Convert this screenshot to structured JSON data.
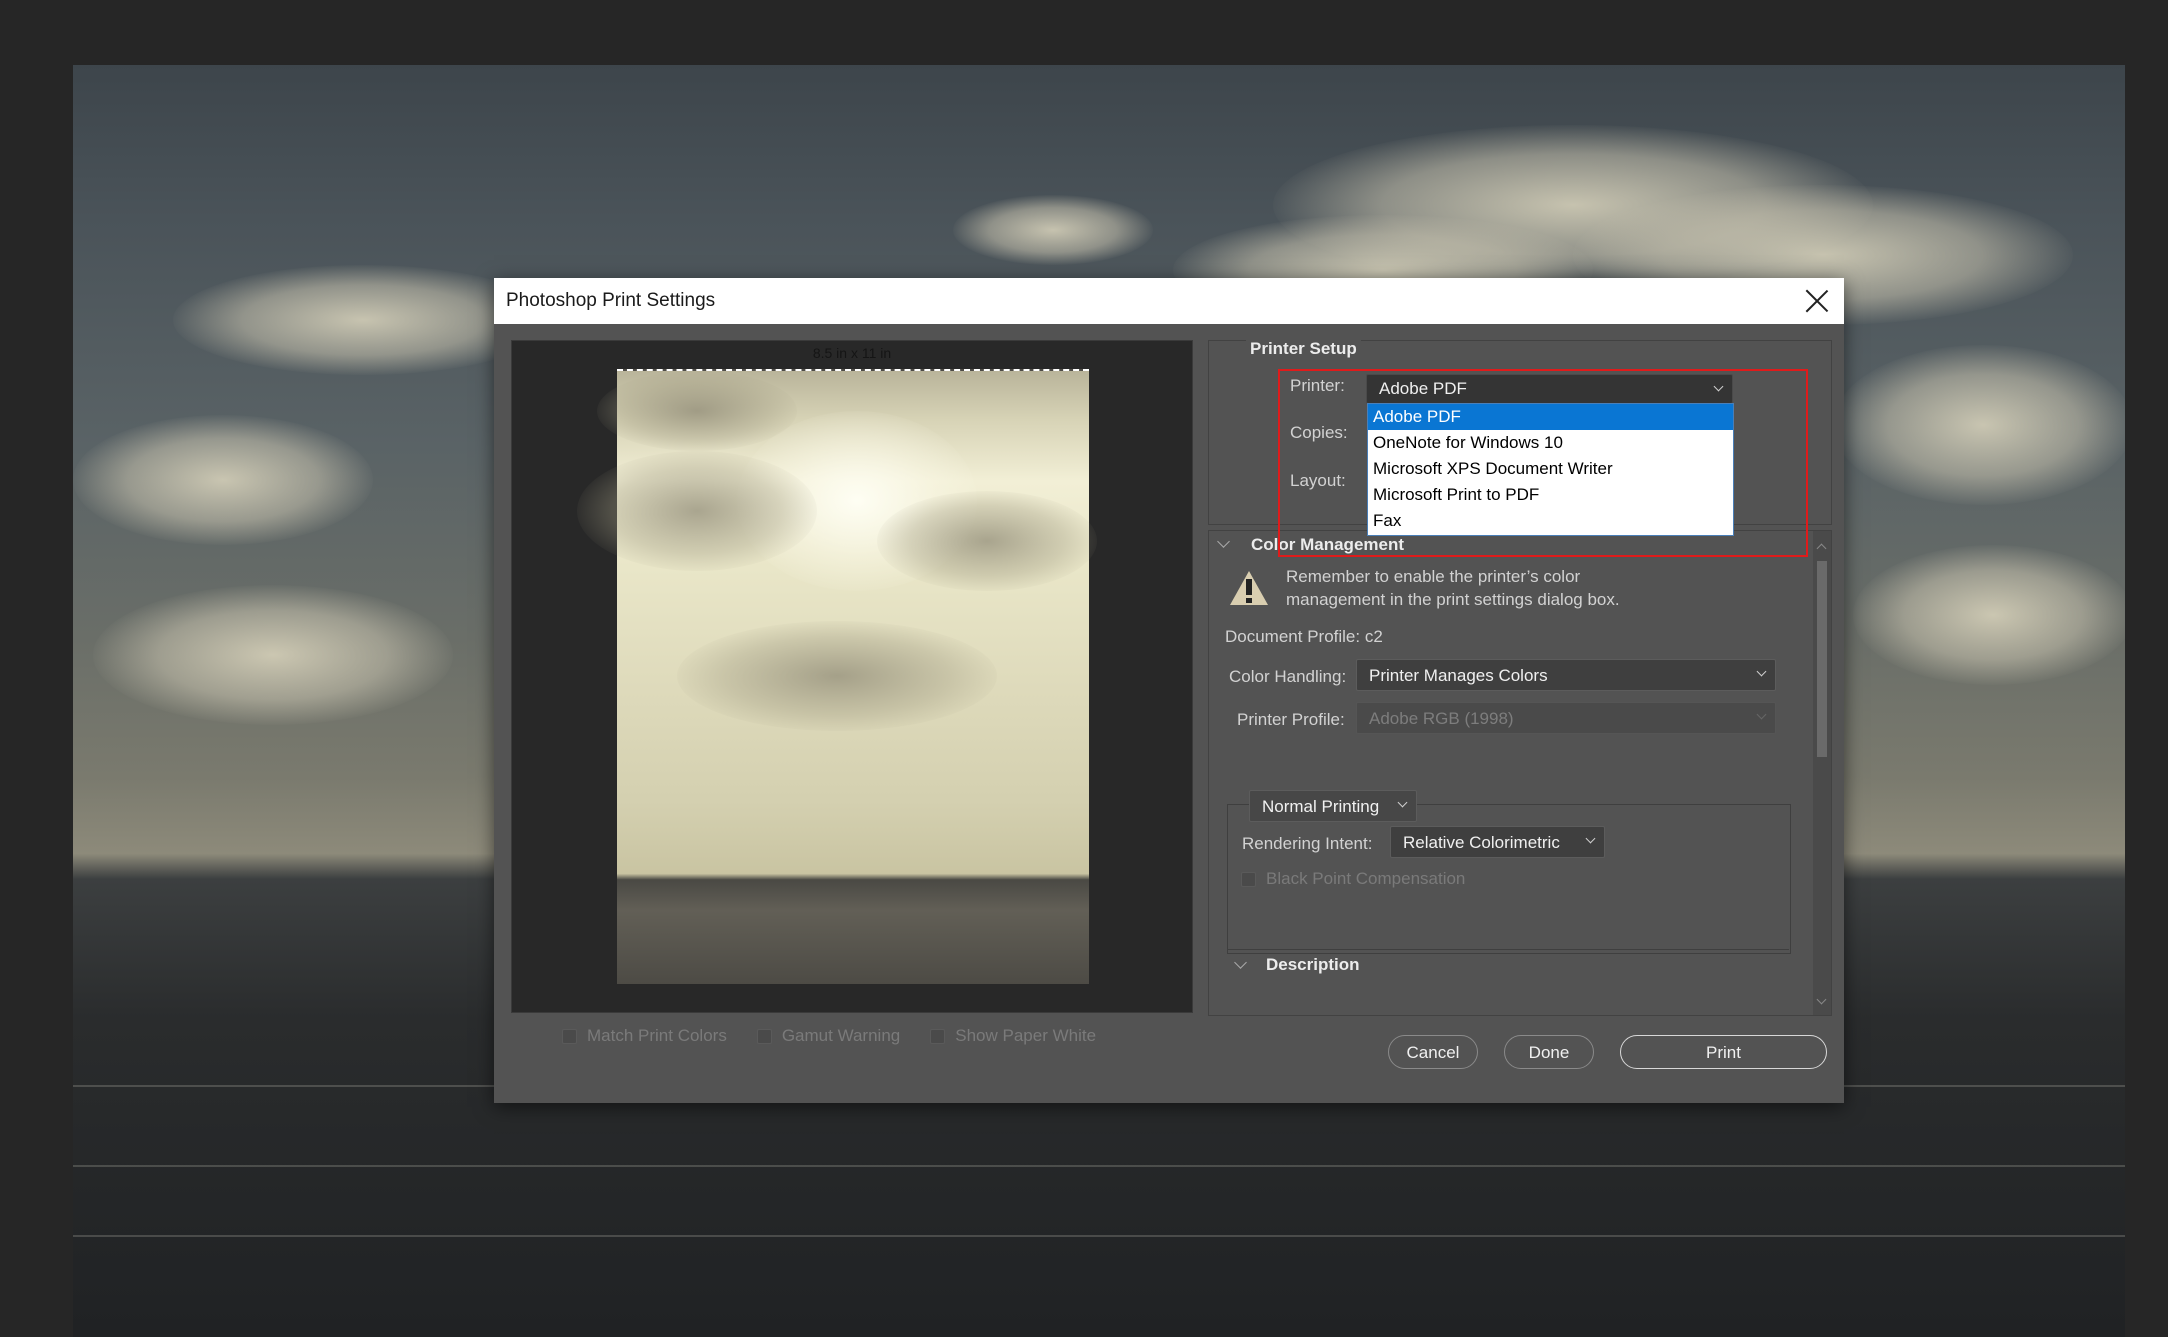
{
  "dialog": {
    "title": "Photoshop Print Settings",
    "close_label": "close"
  },
  "preview": {
    "paper_size": "8.5 in x 11 in",
    "checkboxes": [
      {
        "label": "Match Print Colors",
        "checked": false,
        "enabled": false
      },
      {
        "label": "Gamut Warning",
        "checked": false,
        "enabled": false
      },
      {
        "label": "Show Paper White",
        "checked": false,
        "enabled": false
      }
    ]
  },
  "printer_setup": {
    "title": "Printer Setup",
    "printer_label": "Printer:",
    "printer_value": "Adobe PDF",
    "copies_label": "Copies:",
    "layout_label": "Layout:",
    "printer_options": [
      {
        "label": "Adobe PDF",
        "selected": true
      },
      {
        "label": "OneNote for Windows 10",
        "selected": false
      },
      {
        "label": "Microsoft XPS Document Writer",
        "selected": false
      },
      {
        "label": "Microsoft Print to PDF",
        "selected": false
      },
      {
        "label": "Fax",
        "selected": false
      }
    ]
  },
  "color_management": {
    "title": "Color Management",
    "warning": "Remember to enable the printer's color management in the print settings dialog box.",
    "warning_line1": "Remember to enable the printer’s color",
    "warning_line2": "management in the print settings dialog box.",
    "document_profile": "Document Profile: c2",
    "color_handling_label": "Color Handling:",
    "color_handling_value": "Printer Manages Colors",
    "printer_profile_label": "Printer Profile:",
    "printer_profile_value": "Adobe RGB (1998)",
    "printing_mode": "Normal Printing",
    "rendering_intent_label": "Rendering Intent:",
    "rendering_intent_value": "Relative Colorimetric",
    "black_point_label": "Black Point Compensation"
  },
  "description": {
    "title": "Description"
  },
  "buttons": {
    "cancel": "Cancel",
    "done": "Done",
    "print": "Print"
  },
  "colors": {
    "dialog_bg": "#535353",
    "selection_blue": "#0a76d3",
    "highlight_red": "#e01b1b"
  }
}
